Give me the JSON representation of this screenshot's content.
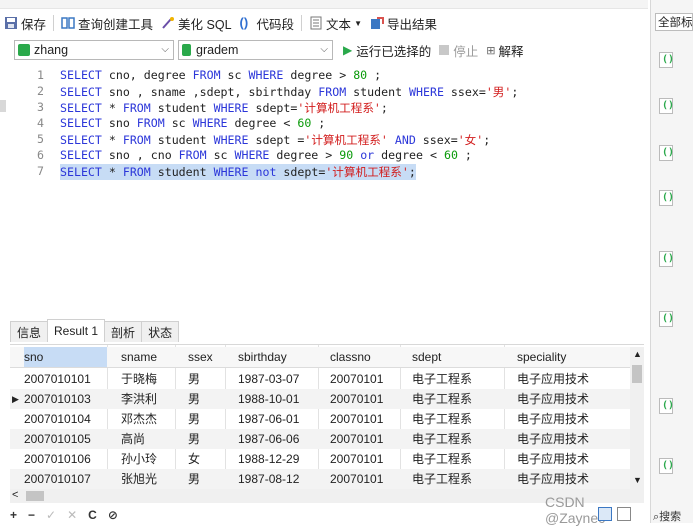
{
  "toolbar": {
    "save": "保存",
    "query_builder": "查询创建工具",
    "beautify": "美化 SQL",
    "snippet": "代码段",
    "text": "文本",
    "export": "导出结果"
  },
  "connection": {
    "name": "zhang",
    "database": "gradem"
  },
  "actions": {
    "run_selected": "运行已选择的",
    "stop": "停止",
    "explain": "解释"
  },
  "editor_lines": [
    {
      "n": "1"
    },
    {
      "n": "2"
    },
    {
      "n": "3"
    },
    {
      "n": "4"
    },
    {
      "n": "5"
    },
    {
      "n": "6"
    },
    {
      "n": "7"
    }
  ],
  "sql": {
    "l1": [
      "SELECT",
      " cno, degree ",
      "FROM",
      " sc ",
      "WHERE",
      " degree > ",
      "80",
      " ;"
    ],
    "l2": [
      "SELECT",
      " sno , sname ,sdept, sbirthday ",
      "FROM",
      " student ",
      "WHERE",
      " ssex=",
      "'男'",
      ";"
    ],
    "l3": [
      "SELECT",
      " * ",
      "FROM",
      " student ",
      "WHERE",
      " sdept=",
      "'计算机工程系'",
      ";"
    ],
    "l4": [
      "SELECT",
      " sno ",
      "FROM",
      " sc ",
      "WHERE",
      " degree < ",
      "60",
      " ;"
    ],
    "l5": [
      "SELECT",
      " * ",
      "FROM",
      " student ",
      "WHERE",
      " sdept =",
      "'计算机工程系'",
      " ",
      "AND",
      " ssex=",
      "'女'",
      ";"
    ],
    "l6": [
      "SELECT",
      " sno , cno ",
      "FROM",
      " sc ",
      "WHERE",
      " degree > ",
      "90",
      " ",
      "or",
      " degree < ",
      "60",
      " ;"
    ],
    "l7": [
      "SELECT",
      " * ",
      "FROM",
      " student ",
      "WHERE",
      " ",
      "not",
      " sdept=",
      "'计算机工程系'",
      ";"
    ]
  },
  "result_tabs": [
    "信息",
    "Result 1",
    "剖析",
    "状态"
  ],
  "columns": [
    "sno",
    "sname",
    "ssex",
    "sbirthday",
    "classno",
    "sdept",
    "speciality"
  ],
  "rows": [
    [
      "2007010101",
      "于晓梅",
      "男",
      "1987-03-07",
      "20070101",
      "电子工程系",
      "电子应用技术"
    ],
    [
      "2007010103",
      "李洪利",
      "男",
      "1988-10-01",
      "20070101",
      "电子工程系",
      "电子应用技术"
    ],
    [
      "2007010104",
      "邓杰杰",
      "男",
      "1987-06-01",
      "20070101",
      "电子工程系",
      "电子应用技术"
    ],
    [
      "2007010105",
      "高尚",
      "男",
      "1987-06-06",
      "20070101",
      "电子工程系",
      "电子应用技术"
    ],
    [
      "2007010106",
      "孙小玲",
      "女",
      "1988-12-29",
      "20070101",
      "电子工程系",
      "电子应用技术"
    ],
    [
      "2007010107",
      "张旭光",
      "男",
      "1987-08-12",
      "20070101",
      "电子工程系",
      "电子应用技术"
    ]
  ],
  "sidebar": {
    "all_tags": "全部标签"
  },
  "bottom_controls": [
    "+",
    "−",
    "✓",
    "✕",
    "C",
    "⊘"
  ],
  "watermark": "CSDN @Zaynec",
  "search_label": "搜索"
}
